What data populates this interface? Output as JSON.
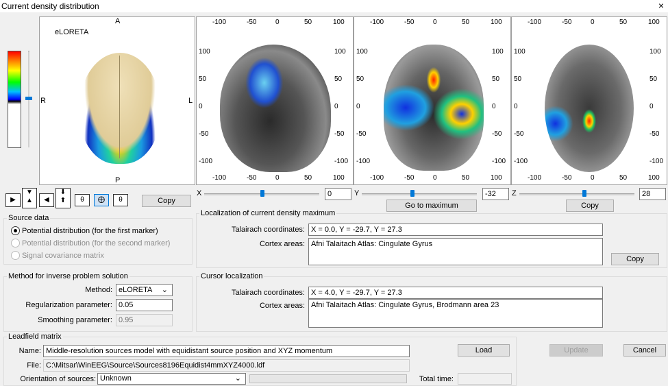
{
  "window": {
    "title": "Current density distribution",
    "close": "×"
  },
  "view3d": {
    "method_label": "eLORETA",
    "orient_top": "A",
    "orient_bottom": "P",
    "orient_left": "R",
    "orient_right": "L"
  },
  "ticks_h": [
    "-100",
    "-50",
    "0",
    "50",
    "100"
  ],
  "ticks_v": [
    "100",
    "50",
    "0",
    "-50",
    "-100"
  ],
  "slices": {
    "x": {
      "axis": "X",
      "value": "0"
    },
    "y": {
      "axis": "Y",
      "value": "-32"
    },
    "z": {
      "axis": "Z",
      "value": "28"
    }
  },
  "buttons": {
    "copy_view": "Copy",
    "go_to_maximum": "Go to maximum",
    "copy_axial": "Copy",
    "copy_localization": "Copy",
    "load": "Load",
    "update": "Update",
    "cancel": "Cancel"
  },
  "source_data": {
    "title": "Source data",
    "options": [
      "Potential distribution (for the first marker)",
      "Potential distribution (for the second marker)",
      "Signal covariance matrix"
    ]
  },
  "method": {
    "title": "Method for inverse problem solution",
    "method_label": "Method:",
    "method_value": "eLORETA",
    "reg_label": "Regularization parameter:",
    "reg_value": "0.05",
    "smooth_label": "Smoothing parameter:",
    "smooth_value": "0.95"
  },
  "localization_max": {
    "title": "Localization of current density maximum",
    "talairach_label": "Talairach coordinates:",
    "talairach_value": "X =  0.0, Y = -29.7, Y =  27.3",
    "cortex_label": "Cortex areas:",
    "cortex_value": "Afni Talaitach Atlas: Cingulate Gyrus"
  },
  "cursor": {
    "title": "Cursor localization",
    "talairach_label": "Talairach coordinates:",
    "talairach_value": "X =  4.0, Y = -29.7, Y =  27.3",
    "cortex_label": "Cortex areas:",
    "cortex_value": "Afni Talaitach Atlas: Cingulate Gyrus, Brodmann area 23"
  },
  "leadfield": {
    "title": "Leadfield matrix",
    "name_label": "Name:",
    "name_value": "Middle-resolution sources model with equidistant source position and XYZ momentum",
    "file_label": "File:",
    "file_value": "C:\\Mitsar\\WinEEG\\Source\\Sources8196Equidist4mmXYZ4000.ldf",
    "orientation_label": "Orientation of sources:",
    "orientation_value": "Unknown",
    "total_time_label": "Total time:",
    "total_time_value": ""
  },
  "colors": {
    "accent": "#0078d7",
    "panel_bg": "#f0f0f0"
  }
}
